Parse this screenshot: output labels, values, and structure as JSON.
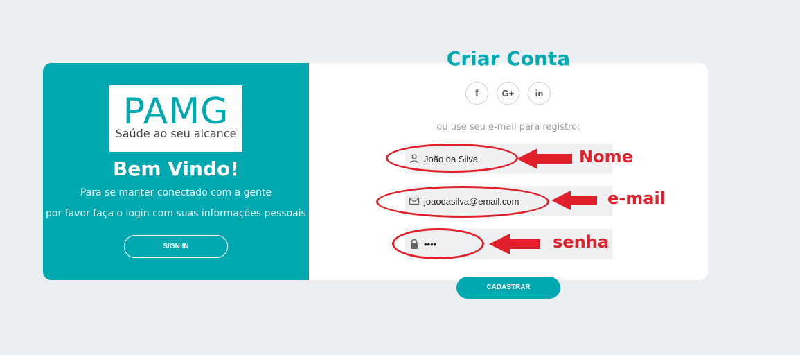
{
  "left": {
    "logo_text": "PAMG",
    "logo_tagline": "Saúde ao seu alcance",
    "welcome": "Bem Vindo!",
    "subtitle_1": "Para se manter conectado com a gente",
    "subtitle_2": "por favor faça o login com suas informações pessoais",
    "signin_label": "SIGN IN"
  },
  "right": {
    "title": "Criar Conta",
    "social": [
      {
        "label": "f",
        "icon": "facebook-icon"
      },
      {
        "label": "G+",
        "icon": "google-plus-icon"
      },
      {
        "label": "in",
        "icon": "linkedin-icon"
      }
    ],
    "hint": "ou use seu e-mail para registro:",
    "name_value": "João da Silva",
    "email_value": "joaodasilva@email.com",
    "password_value": "••••",
    "submit_label": "CADASTRAR"
  },
  "annotations": {
    "name": "Nome",
    "email": "e-mail",
    "password": "senha",
    "color": "#e0202a"
  },
  "colors": {
    "accent": "#00a8b0",
    "background": "#eceff1",
    "field_bg": "#eef0f1"
  }
}
